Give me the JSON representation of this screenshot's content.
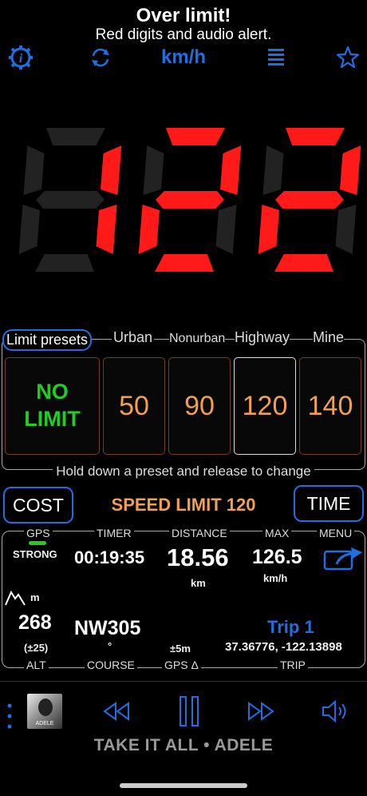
{
  "header": {
    "title": "Over limit!",
    "subtitle": "Red digits and audio alert.",
    "unit": "km/h",
    "icons": [
      "info-gear-icon",
      "refresh-icon",
      "list-icon",
      "star-icon"
    ]
  },
  "speed": {
    "value": "122",
    "color": "#ff1a1a"
  },
  "presets": {
    "headers": [
      "Limit presets",
      "Urban",
      "Nonurban",
      "Highway",
      "Mine"
    ],
    "tiles": [
      "NO LIMIT",
      "50",
      "90",
      "120",
      "140"
    ],
    "hint": "Hold down a preset and release to change"
  },
  "limit_bar": {
    "cost": "COST",
    "label": "SPEED LIMIT 120",
    "time": "TIME"
  },
  "stats": {
    "labels_top": {
      "gps": "GPS",
      "timer": "TIMER",
      "distance": "DISTANCE",
      "max": "MAX",
      "menu": "MENU"
    },
    "gps_strength": "STRONG",
    "timer": "00:19:35",
    "distance": "18.56",
    "distance_unit": "km",
    "max": "126.5",
    "max_unit": "km/h",
    "alt_unit": "m",
    "alt": "268",
    "alt_acc": "(±25)",
    "course": "NW305",
    "course_unit": "°",
    "gps_delta": "±5m",
    "trip_name": "Trip 1",
    "coords": "37.36776, -122.13898",
    "labels_bottom": {
      "alt": "ALT",
      "course": "COURSE",
      "gps": "GPS Δ",
      "trip": "TRIP"
    }
  },
  "media": {
    "album_text": "ADELE",
    "song": "TAKE IT ALL • ADELE"
  }
}
